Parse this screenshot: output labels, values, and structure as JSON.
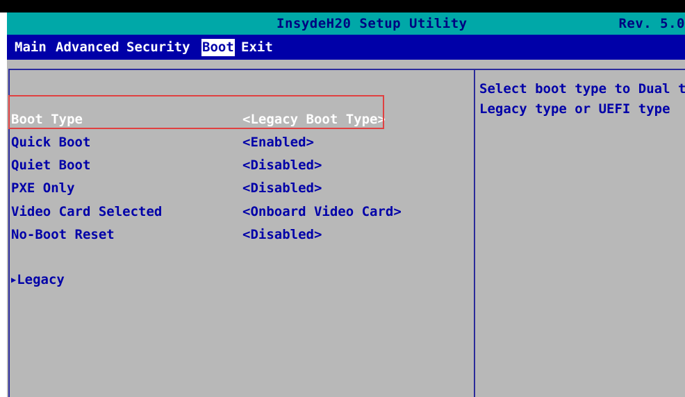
{
  "header": {
    "title": "InsydeH20 Setup Utility",
    "revision": "Rev. 5.0"
  },
  "menu": {
    "items": [
      {
        "label": "Main"
      },
      {
        "label": "Advanced"
      },
      {
        "label": "Security"
      },
      {
        "label": "Boot"
      },
      {
        "label": "Exit"
      }
    ],
    "active": "Boot"
  },
  "settings": [
    {
      "label": "Boot Type",
      "value": "<Legacy Boot Type>"
    },
    {
      "label": "Quick Boot",
      "value": "<Enabled>"
    },
    {
      "label": "Quiet Boot",
      "value": "<Disabled>"
    },
    {
      "label": "PXE Only",
      "value": "<Disabled>"
    },
    {
      "label": "Video Card Selected",
      "value": "<Onboard Video Card>"
    },
    {
      "label": "No-Boot Reset",
      "value": "<Disabled>"
    }
  ],
  "submenu": {
    "arrow": "▶",
    "label": "Legacy"
  },
  "help": {
    "line1": "Select boot type to Dual type,",
    "line2": "Legacy type or UEFI type"
  },
  "colors": {
    "title_bar": "#00a8a8",
    "menu_bar": "#0000a8",
    "content_bg": "#b8b8b8",
    "text": "#0000a8",
    "highlight": "#e04040"
  }
}
